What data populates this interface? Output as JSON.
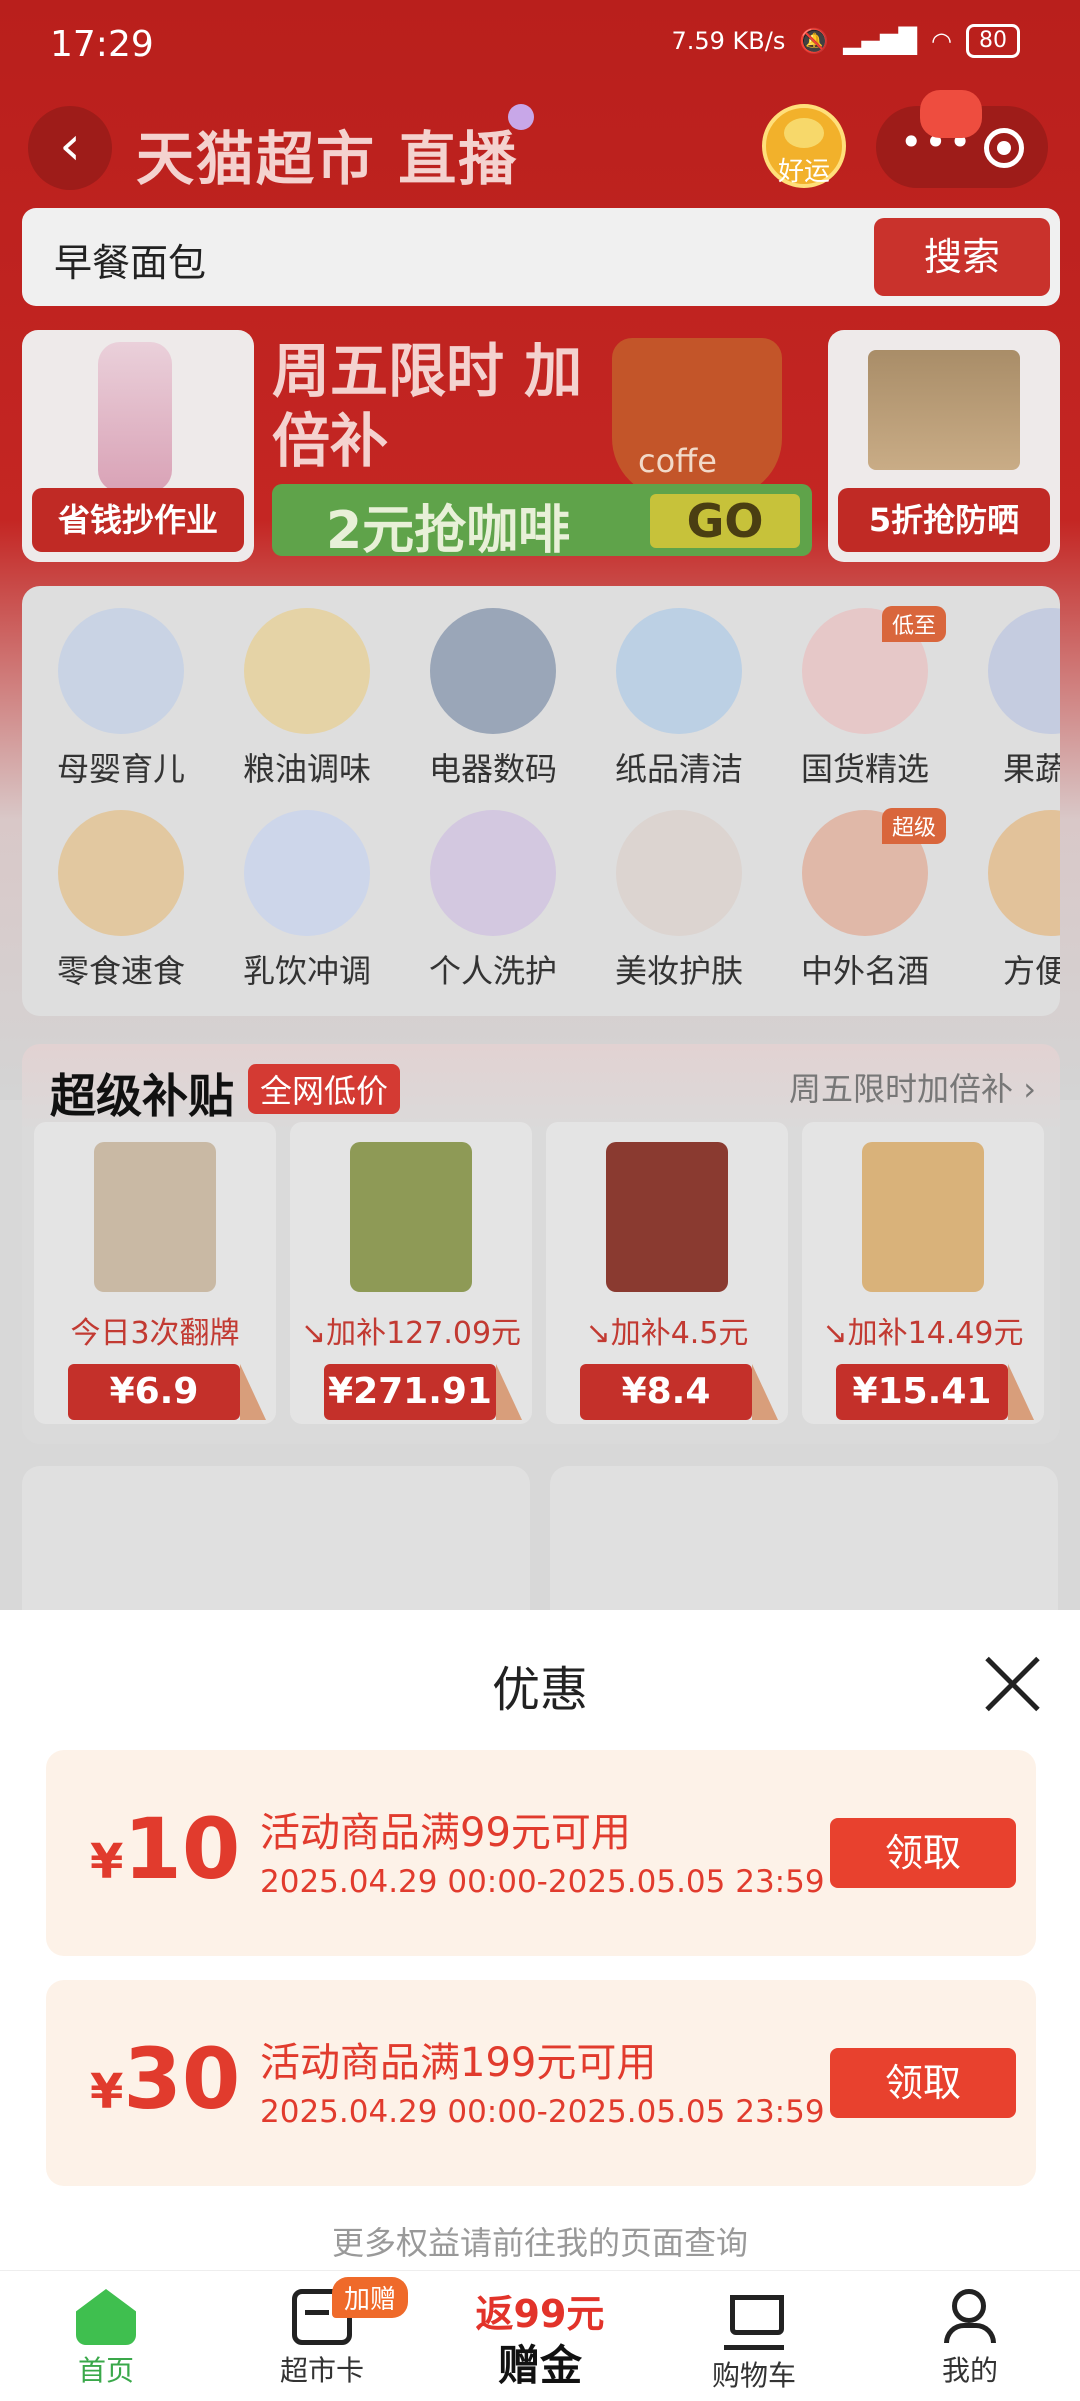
{
  "status_bar": {
    "time": "17:29",
    "net_speed": "7.59 KB/s",
    "battery": "80"
  },
  "header": {
    "title": "天猫超市 直播",
    "lucky_label": "好运"
  },
  "search": {
    "query": "早餐面包",
    "button": "搜索"
  },
  "promos": {
    "left_label": "省钱抄作业",
    "center_headline": "周五限时 加倍补",
    "center_cup_text": "coffe",
    "center_bar_text": "2元抢咖啡",
    "center_go": "GO",
    "right_label": "5折抢防晒"
  },
  "categories": [
    {
      "label": "母婴育儿",
      "tag": "",
      "color": "#c9d3e4"
    },
    {
      "label": "粮油调味",
      "tag": "",
      "color": "#e5d3a6"
    },
    {
      "label": "电器数码",
      "tag": "",
      "color": "#9aa6b8"
    },
    {
      "label": "纸品清洁",
      "tag": "",
      "color": "#bcd0e4"
    },
    {
      "label": "国货精选",
      "tag": "低至",
      "color": "#e6c8c8"
    },
    {
      "label": "果蔬生",
      "tag": "",
      "color": "#c5cce0"
    },
    {
      "label": "零食速食",
      "tag": "",
      "color": "#e2c8a0"
    },
    {
      "label": "乳饮冲调",
      "tag": "",
      "color": "#cdd6ea"
    },
    {
      "label": "个人洗护",
      "tag": "",
      "color": "#d3c8e0"
    },
    {
      "label": "美妆护肤",
      "tag": "",
      "color": "#dcd4d0"
    },
    {
      "label": "中外名酒",
      "tag": "超级",
      "color": "#e0b8a8"
    },
    {
      "label": "方便食",
      "tag": "",
      "color": "#e2c29a"
    }
  ],
  "subsidy": {
    "title": "超级补贴",
    "tag": "全网低价",
    "link": "周五限时加倍补 ›",
    "products": [
      {
        "label": "今日3次翻牌",
        "price": "¥6.9",
        "color": "#c9b9a4"
      },
      {
        "label": "↘加补127.09元",
        "price": "¥271.91",
        "color": "#8e9a56"
      },
      {
        "label": "↘加补4.5元",
        "price": "¥8.4",
        "color": "#8a3a30"
      },
      {
        "label": "↘加补14.49元",
        "price": "¥15.41",
        "color": "#d9b27a"
      }
    ]
  },
  "sheet": {
    "title": "优惠",
    "coupons": [
      {
        "currency": "¥",
        "amount": "10",
        "condition": "活动商品满99元可用",
        "date": "2025.04.29 00:00-2025.05.05 23:59",
        "button": "领取"
      },
      {
        "currency": "¥",
        "amount": "30",
        "condition": "活动商品满199元可用",
        "date": "2025.04.29 00:00-2025.05.05 23:59",
        "button": "领取"
      }
    ],
    "footer": "更多权益请前往我的页面查询"
  },
  "tabbar": {
    "home": "首页",
    "card": "超市卡",
    "card_badge": "加赠",
    "center_top": "返99元",
    "center_bottom": "赠金",
    "cart": "购物车",
    "me": "我的"
  }
}
